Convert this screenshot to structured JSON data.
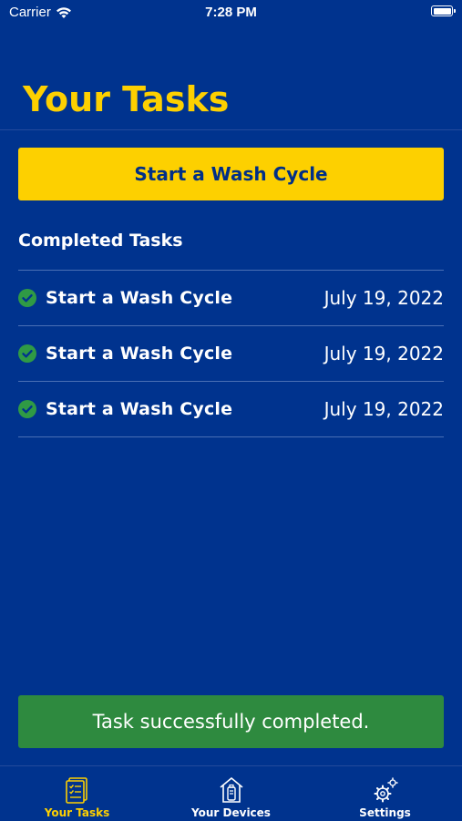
{
  "status_bar": {
    "carrier": "Carrier",
    "time": "7:28 PM"
  },
  "header": {
    "title": "Your Tasks"
  },
  "primary_action": {
    "label": "Start a Wash Cycle"
  },
  "completed_section": {
    "title": "Completed Tasks",
    "items": [
      {
        "name": "Start a Wash Cycle",
        "date": "July 19, 2022",
        "status_icon": "check-circle-icon"
      },
      {
        "name": "Start a Wash Cycle",
        "date": "July 19, 2022",
        "status_icon": "check-circle-icon"
      },
      {
        "name": "Start a Wash Cycle",
        "date": "July 19, 2022",
        "status_icon": "check-circle-icon"
      }
    ]
  },
  "toast": {
    "message": "Task successfully completed."
  },
  "tab_bar": {
    "tabs": [
      {
        "label": "Your Tasks",
        "icon": "tasks-clipboard-icon",
        "active": true
      },
      {
        "label": "Your Devices",
        "icon": "devices-home-icon",
        "active": false
      },
      {
        "label": "Settings",
        "icon": "settings-gear-icon",
        "active": false
      }
    ]
  },
  "colors": {
    "background": "#00338e",
    "accent": "#fdd000",
    "success": "#2e8a3f",
    "check": "#2f9a45"
  }
}
